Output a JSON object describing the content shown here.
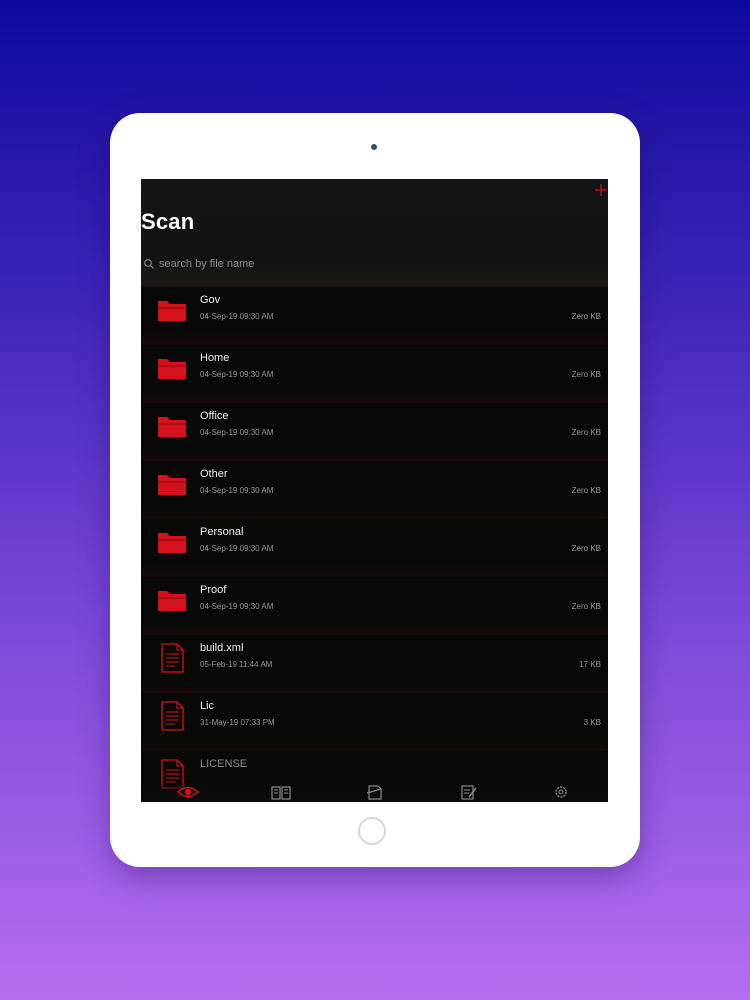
{
  "header": {
    "title": "Scan",
    "add_icon": "plus-icon",
    "search_placeholder": "search by file name",
    "search_value": ""
  },
  "colors": {
    "accent": "#d4121c",
    "screen_bg": "#0b0b0b",
    "row_bg": "#080808",
    "text_primary": "#f0f0f0",
    "text_secondary": "#9a9a9a"
  },
  "files": [
    {
      "name": "Gov",
      "date": "04-Sep-19 09:30 AM",
      "size": "Zero KB",
      "icon": "folder-icon"
    },
    {
      "name": "Home",
      "date": "04-Sep-19 09:30 AM",
      "size": "Zero KB",
      "icon": "folder-icon"
    },
    {
      "name": "Office",
      "date": "04-Sep-19 09:30 AM",
      "size": "Zero KB",
      "icon": "folder-icon"
    },
    {
      "name": "Other",
      "date": "04-Sep-19 09:30 AM",
      "size": "Zero KB",
      "icon": "folder-icon"
    },
    {
      "name": "Personal",
      "date": "04-Sep-19 09:30 AM",
      "size": "Zero KB",
      "icon": "folder-icon"
    },
    {
      "name": "Proof",
      "date": "04-Sep-19 09:30 AM",
      "size": "Zero KB",
      "icon": "folder-icon"
    },
    {
      "name": "build.xml",
      "date": "05-Feb-19 11:44 AM",
      "size": "17 KB",
      "icon": "document-icon"
    },
    {
      "name": "Lic",
      "date": "31-May-19 07:33 PM",
      "size": "3 KB",
      "icon": "document-icon"
    },
    {
      "name": "LICENSE",
      "date": "",
      "size": "",
      "icon": "document-icon"
    }
  ],
  "tabbar": {
    "tabs": [
      {
        "icon": "eye-icon",
        "active": true
      },
      {
        "icon": "book-icon",
        "active": false
      },
      {
        "icon": "scan-document-icon",
        "active": false
      },
      {
        "icon": "edit-document-icon",
        "active": false
      },
      {
        "icon": "gear-icon",
        "active": false
      }
    ]
  }
}
